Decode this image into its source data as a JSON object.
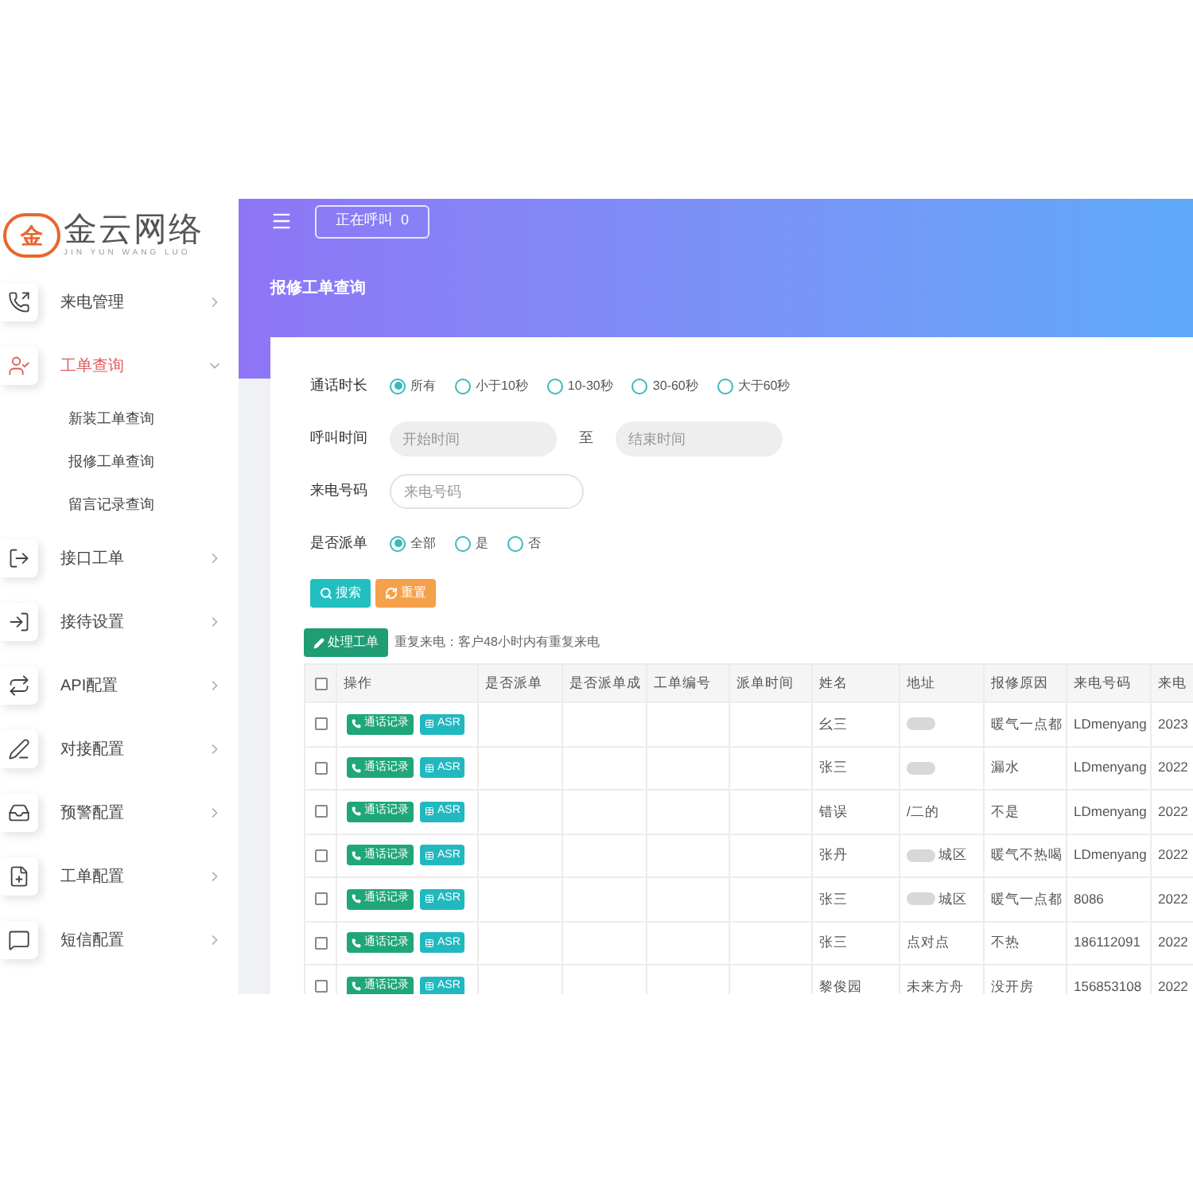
{
  "logo": {
    "mark": "金",
    "name": "金云网络",
    "pinyin": "JIN YUN WANG LUO"
  },
  "sidebar": {
    "items": [
      {
        "label": "来电管理",
        "kind": "phone",
        "selected": false,
        "expanded": false
      },
      {
        "label": "工单查询",
        "kind": "user",
        "selected": true,
        "expanded": true,
        "children": [
          {
            "label": "新装工单查询"
          },
          {
            "label": "报修工单查询"
          },
          {
            "label": "留言记录查询"
          }
        ]
      },
      {
        "label": "接口工单",
        "kind": "logout",
        "selected": false,
        "expanded": false
      },
      {
        "label": "接待设置",
        "kind": "login",
        "selected": false,
        "expanded": false
      },
      {
        "label": "API配置",
        "kind": "repeat",
        "selected": false,
        "expanded": false
      },
      {
        "label": "对接配置",
        "kind": "pen",
        "selected": false,
        "expanded": false
      },
      {
        "label": "预警配置",
        "kind": "inbox",
        "selected": false,
        "expanded": false
      },
      {
        "label": "工单配置",
        "kind": "file",
        "selected": false,
        "expanded": false
      },
      {
        "label": "短信配置",
        "kind": "message",
        "selected": false,
        "expanded": false
      }
    ]
  },
  "topbar": {
    "calling_button": "正在呼叫  0"
  },
  "page_title": "报修工单查询",
  "filters": [
    {
      "kind": "radio",
      "label": "通话时长",
      "options": [
        {
          "label": "所有",
          "selected": true
        },
        {
          "label": "小于10秒",
          "selected": false
        },
        {
          "label": "10-30秒",
          "selected": false
        },
        {
          "label": "30-60秒",
          "selected": false
        },
        {
          "label": "大于60秒",
          "selected": false
        }
      ]
    },
    {
      "kind": "range",
      "label": "呼叫时间",
      "start_placeholder": "开始时间",
      "separator": "至",
      "end_placeholder": "结束时间"
    },
    {
      "kind": "text",
      "label": "来电号码",
      "placeholder": "来电号码"
    },
    {
      "kind": "radio",
      "label": "是否派单",
      "options": [
        {
          "label": "全部",
          "selected": true
        },
        {
          "label": "是",
          "selected": false
        },
        {
          "label": "否",
          "selected": false
        }
      ]
    }
  ],
  "actions": {
    "search": "搜索",
    "reset": "重置"
  },
  "toolbar": {
    "process_button": "处理工单",
    "notice": "重复来电：客户48小时内有重复来电"
  },
  "table": {
    "header_checked": false,
    "columns": [
      "操作",
      "是否派单",
      "是否派单成",
      "工单编号",
      "派单时间",
      "姓名",
      "地址",
      "报修原因",
      "来电号码",
      "来电"
    ],
    "rows": [
      {
        "checked": false,
        "buttons": [
          "通话记录",
          "ASR"
        ],
        "name": "幺三",
        "address": "",
        "address_blurred": true,
        "reason": "暖气一点都",
        "phone": "LDmenyang",
        "time": "2023"
      },
      {
        "checked": false,
        "buttons": [
          "通话记录",
          "ASR"
        ],
        "name": "张三",
        "address": "",
        "address_blurred": true,
        "reason": "漏水",
        "phone": "LDmenyang",
        "time": "2022"
      },
      {
        "checked": false,
        "buttons": [
          "通话记录",
          "ASR"
        ],
        "name": "错误",
        "address": "/二的",
        "address_blurred": false,
        "reason": "不是",
        "phone": "LDmenyang",
        "time": "2022"
      },
      {
        "checked": false,
        "buttons": [
          "通话记录",
          "ASR"
        ],
        "name": "张丹",
        "address": "城区",
        "address_blurred": true,
        "reason": "暖气不热喝",
        "phone": "LDmenyang",
        "time": "2022"
      },
      {
        "checked": false,
        "buttons": [
          "通话记录",
          "ASR"
        ],
        "name": "张三",
        "address": "城区",
        "address_blurred": true,
        "reason": "暖气一点都",
        "phone": "8086",
        "time": "2022"
      },
      {
        "checked": false,
        "buttons": [
          "通话记录",
          "ASR"
        ],
        "name": "张三",
        "address": "点对点",
        "address_blurred": false,
        "reason": "不热",
        "phone": "186112091",
        "time": "2022"
      },
      {
        "checked": false,
        "buttons": [
          "通话记录",
          "ASR"
        ],
        "name": "黎俊园",
        "address": "未来方舟",
        "address_blurred": false,
        "reason": "没开房",
        "phone": "156853108",
        "time": "2022"
      }
    ]
  }
}
